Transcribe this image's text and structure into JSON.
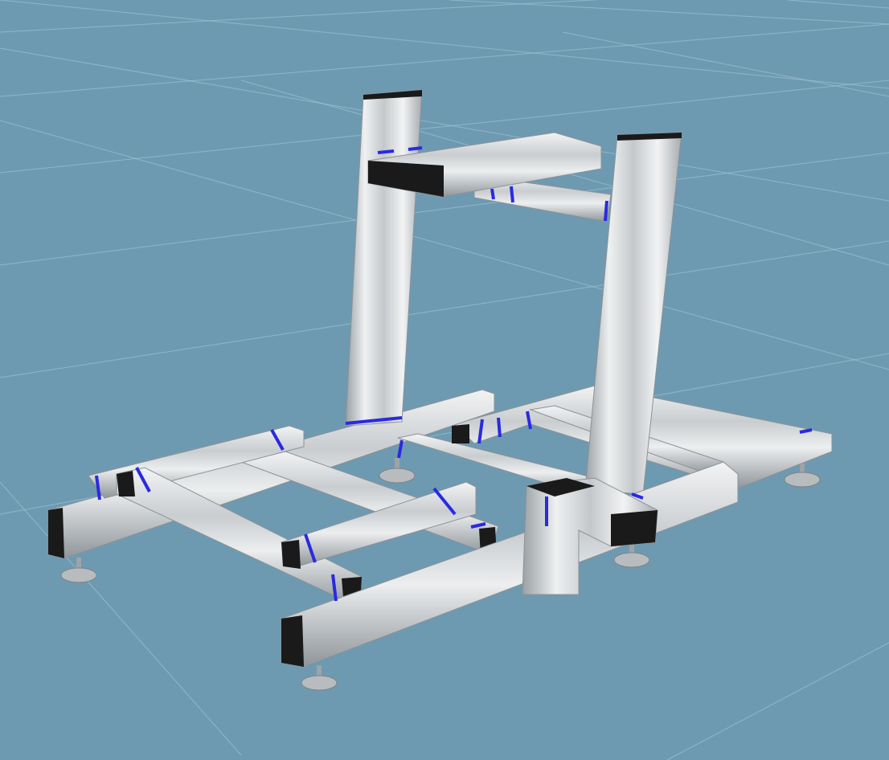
{
  "viewport": {
    "background_color": "#6e9ab1",
    "grid_color": "#a9cde0",
    "profile_color": "#dcdedf",
    "profile_shadow_color": "#8c9296",
    "end_cap_color": "#1a1a1a",
    "connector_color": "#2a2ae0",
    "foot_color": "#b8bcbf"
  }
}
